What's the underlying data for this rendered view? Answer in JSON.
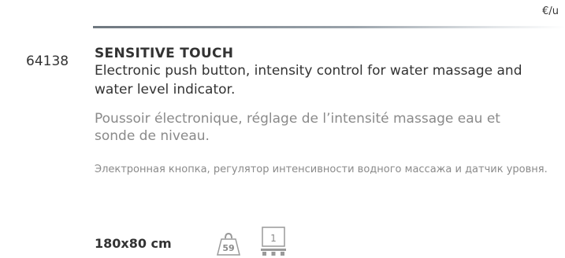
{
  "header": {
    "unit": "€/u"
  },
  "product": {
    "code": "64138",
    "name": "SENSITIVE TOUCH",
    "description_en": "Electronic push button, intensity control for water massage and water level indicator.",
    "description_fr": "Poussoir électronique, réglage de l’intensité massage eau et sonde de niveau.",
    "description_ru": "Электронная кнопка, регулятор интенсивности водного массажа и датчик уровня.",
    "dimensions": "180x80 cm",
    "weight": "59",
    "pallet_quantity": "1"
  },
  "icons": {
    "weight": "weight-icon",
    "pallet": "pallet-icon"
  },
  "colors": {
    "text": "#333333",
    "muted_text": "#8a8a8a",
    "rule": "#6f7880",
    "background": "#ffffff"
  }
}
